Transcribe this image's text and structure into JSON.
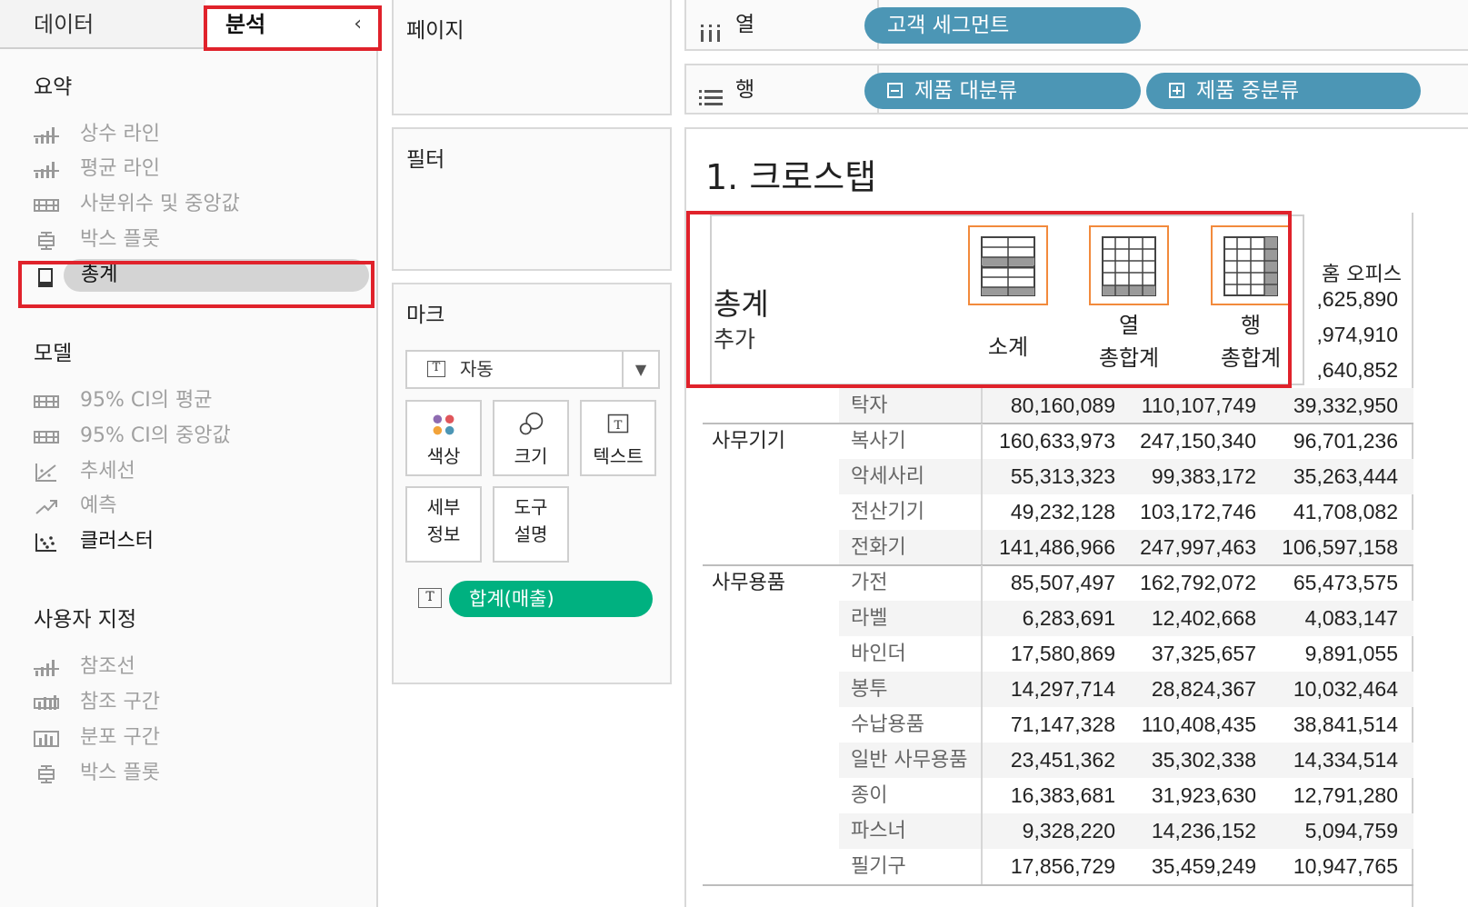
{
  "left_pane": {
    "tabs": {
      "data": "데이터",
      "analysis": "분석"
    },
    "sections": {
      "summary": {
        "title": "요약",
        "items": [
          "상수 라인",
          "평균 라인",
          "사분위수 및 중앙값",
          "박스 플롯",
          "총계"
        ]
      },
      "model": {
        "title": "모델",
        "items": [
          "95% CI의 평균",
          "95% CI의 중앙값",
          "추세선",
          "예측",
          "클러스터"
        ]
      },
      "custom": {
        "title": "사용자 지정",
        "items": [
          "참조선",
          "참조 구간",
          "분포 구간",
          "박스 플롯"
        ]
      }
    }
  },
  "cards": {
    "pages": "페이지",
    "filters": "필터",
    "marks": {
      "title": "마크",
      "type": "자동",
      "buttons": {
        "color": "색상",
        "size": "크기",
        "text": "텍스트",
        "detail": "세부\n정보",
        "tooltip": "도구\n설명"
      },
      "field": "합계(매출)"
    }
  },
  "shelves": {
    "columns": {
      "label": "열",
      "pills": [
        "고객 세그먼트"
      ]
    },
    "rows": {
      "label": "행",
      "pills": [
        "제품 대분류",
        "제품 중분류"
      ]
    }
  },
  "sheet": {
    "title": "1. 크로스탭",
    "visible_header": "홈 오피스",
    "partial_values": [
      ",625,890",
      ",974,910",
      ",640,852"
    ],
    "rows": [
      {
        "cat": "",
        "sub": "탁자",
        "v": [
          "80,160,089",
          "110,107,749",
          "39,332,950"
        ]
      },
      {
        "cat": "사무기기",
        "sub": "복사기",
        "v": [
          "160,633,973",
          "247,150,340",
          "96,701,236"
        ]
      },
      {
        "cat": "",
        "sub": "악세사리",
        "v": [
          "55,313,323",
          "99,383,172",
          "35,263,444"
        ]
      },
      {
        "cat": "",
        "sub": "전산기기",
        "v": [
          "49,232,128",
          "103,172,746",
          "41,708,082"
        ]
      },
      {
        "cat": "",
        "sub": "전화기",
        "v": [
          "141,486,966",
          "247,997,463",
          "106,597,158"
        ]
      },
      {
        "cat": "사무용품",
        "sub": "가전",
        "v": [
          "85,507,497",
          "162,792,072",
          "65,473,575"
        ]
      },
      {
        "cat": "",
        "sub": "라벨",
        "v": [
          "6,283,691",
          "12,402,668",
          "4,083,147"
        ]
      },
      {
        "cat": "",
        "sub": "바인더",
        "v": [
          "17,580,869",
          "37,325,657",
          "9,891,055"
        ]
      },
      {
        "cat": "",
        "sub": "봉투",
        "v": [
          "14,297,714",
          "28,824,367",
          "10,032,464"
        ]
      },
      {
        "cat": "",
        "sub": "수납용품",
        "v": [
          "71,147,328",
          "110,408,435",
          "38,841,514"
        ]
      },
      {
        "cat": "",
        "sub": "일반 사무용품",
        "v": [
          "23,451,362",
          "35,302,338",
          "14,334,514"
        ]
      },
      {
        "cat": "",
        "sub": "종이",
        "v": [
          "16,383,681",
          "31,923,630",
          "12,791,280"
        ]
      },
      {
        "cat": "",
        "sub": "파스너",
        "v": [
          "9,328,220",
          "14,236,152",
          "5,094,759"
        ]
      },
      {
        "cat": "",
        "sub": "필기구",
        "v": [
          "17,856,729",
          "35,459,249",
          "10,947,765"
        ]
      }
    ]
  },
  "totals_popup": {
    "title": "총계",
    "subtitle": "추가",
    "options": [
      {
        "label": "소계"
      },
      {
        "label": "열\n총합계"
      },
      {
        "label": "행\n총합계"
      }
    ]
  },
  "colors": {
    "highlight": "#e0222b",
    "dimension_pill": "#4c96b5",
    "measure_pill": "#00b180",
    "option_border": "#f28a3c"
  }
}
